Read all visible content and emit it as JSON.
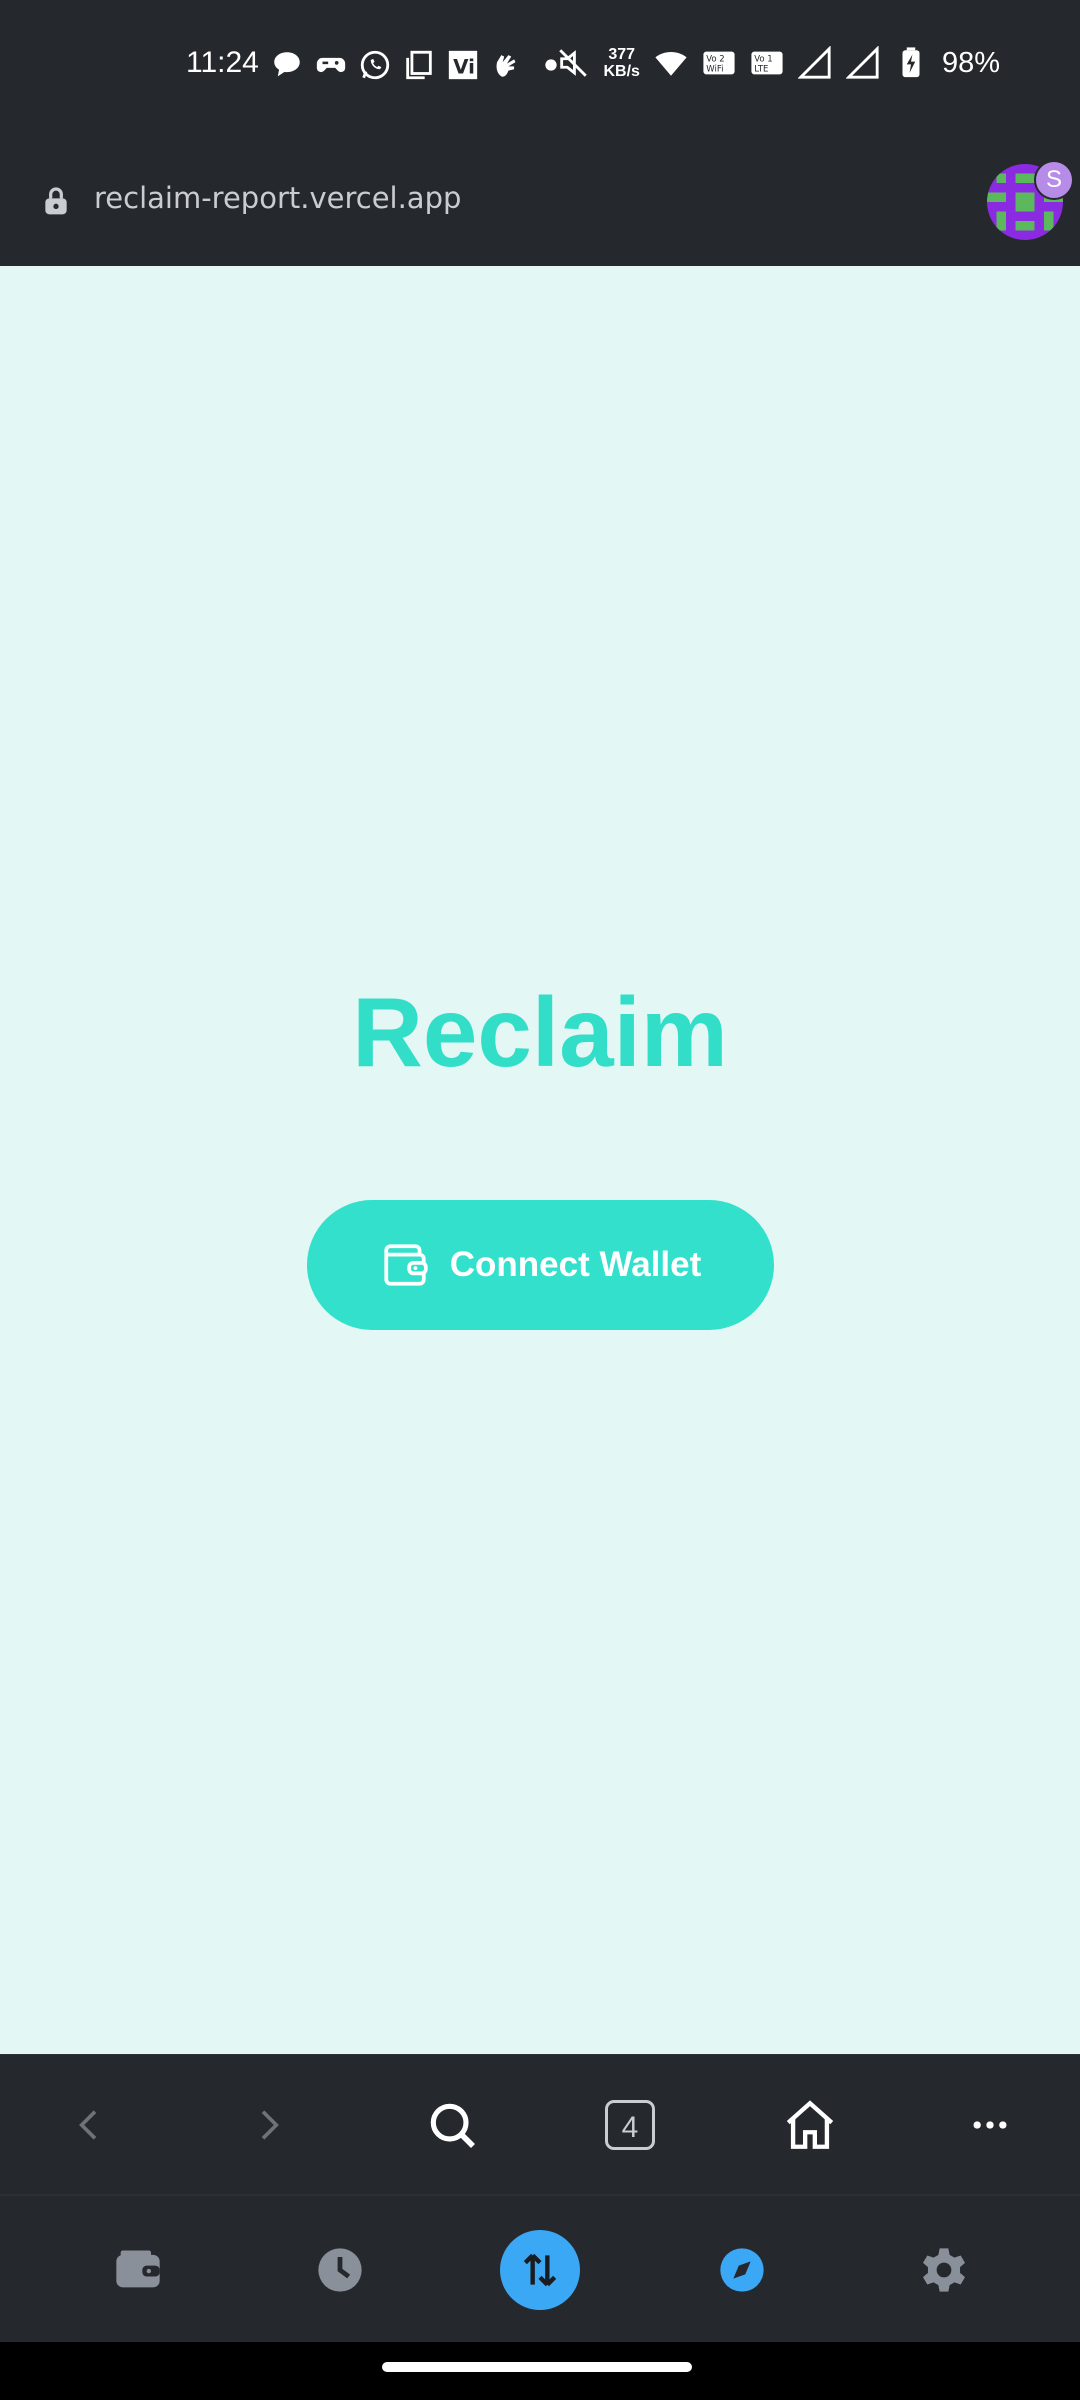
{
  "status_bar": {
    "time": "11:24",
    "net_speed_value": "377",
    "net_speed_unit": "KB/s",
    "battery": "98%",
    "vowifi_label": "Vo WiFi",
    "volte_label": "Vo LTE"
  },
  "browser": {
    "url": "reclaim-report.vercel.app",
    "avatar_badge": "S",
    "tab_count": "4"
  },
  "page": {
    "title": "Reclaim",
    "connect_label": "Connect Wallet"
  },
  "colors": {
    "accent": "#33dec8",
    "page_background": "#e3f7f4",
    "chrome_background": "#25282c",
    "active_nav": "#3ba8f5"
  },
  "wallet_nav": {
    "items": [
      "wallet-icon",
      "history-icon",
      "swap-icon",
      "browser-compass-icon",
      "settings-gear-icon"
    ]
  }
}
